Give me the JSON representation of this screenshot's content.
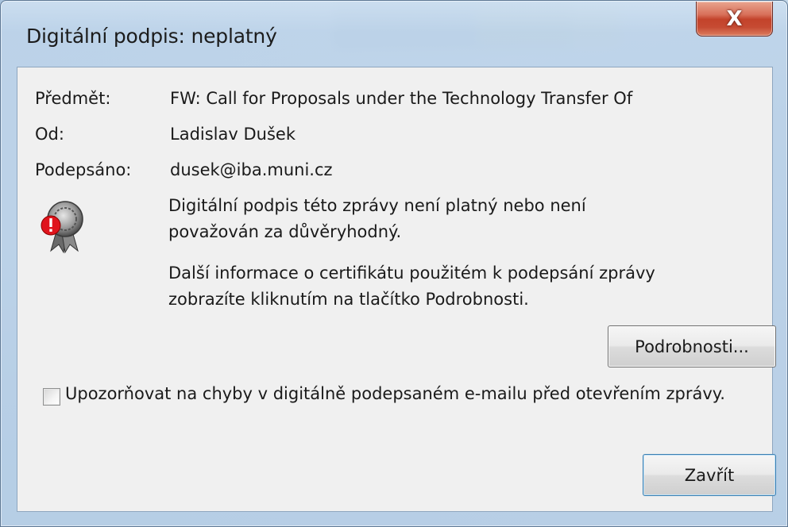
{
  "dialog": {
    "title": "Digitální podpis: neplatný",
    "close_glyph": "X",
    "fields": {
      "subject_label": "Předmět:",
      "subject_value": "FW: Call for Proposals under the Technology Transfer Of",
      "from_label": "Od:",
      "from_value": "Ladislav Dušek",
      "signed_label": "Podepsáno:",
      "signed_value": "dusek@iba.muni.cz"
    },
    "status_icon": "invalid-certificate-seal-icon",
    "message_line_1": "Digitální podpis této zprávy není platný nebo není považován za důvěryhodný.",
    "message_line_2": "Další informace o certifikátu použitém k podepsání zprávy zobrazíte kliknutím na tlačítko Podrobnosti.",
    "details_button": "Podrobnosti...",
    "warn_checkbox_label": "Upozorňovat na chyby v digitálně podepsaném e-mailu před otevřením zprávy.",
    "warn_checkbox_checked": false,
    "close_button": "Zavřít"
  },
  "colors": {
    "frame": "#b7cde2",
    "client_bg": "#f0f0f0",
    "close_red": "#c3432b",
    "error_badge": "#e0141c"
  }
}
